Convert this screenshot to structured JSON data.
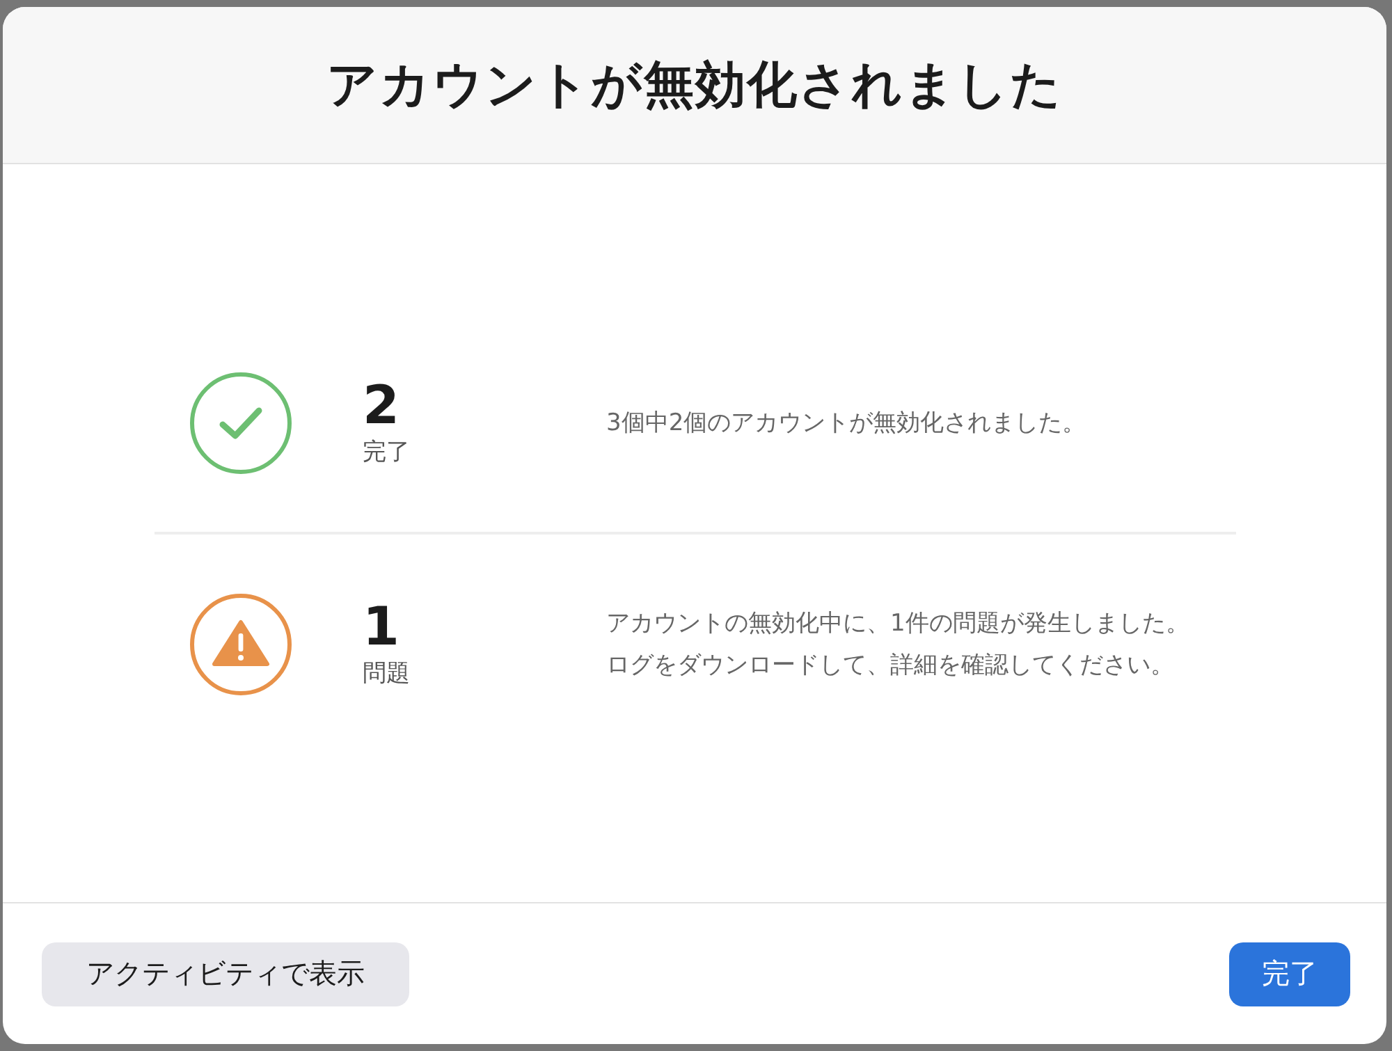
{
  "dialog": {
    "title": "アカウントが無効化されました"
  },
  "results": [
    {
      "kind": "success",
      "count": "2",
      "label": "完了",
      "message": "3個中2個のアカウントが無効化されました。"
    },
    {
      "kind": "warning",
      "count": "1",
      "label": "問題",
      "message": "アカウントの無効化中に、1件の問題が発生しました。ログをダウンロードして、詳細を確認してください。"
    }
  ],
  "buttons": [
    {
      "kind": "secondary",
      "label": "アクティビティで表示"
    },
    {
      "kind": "primary",
      "label": "完了"
    }
  ]
}
